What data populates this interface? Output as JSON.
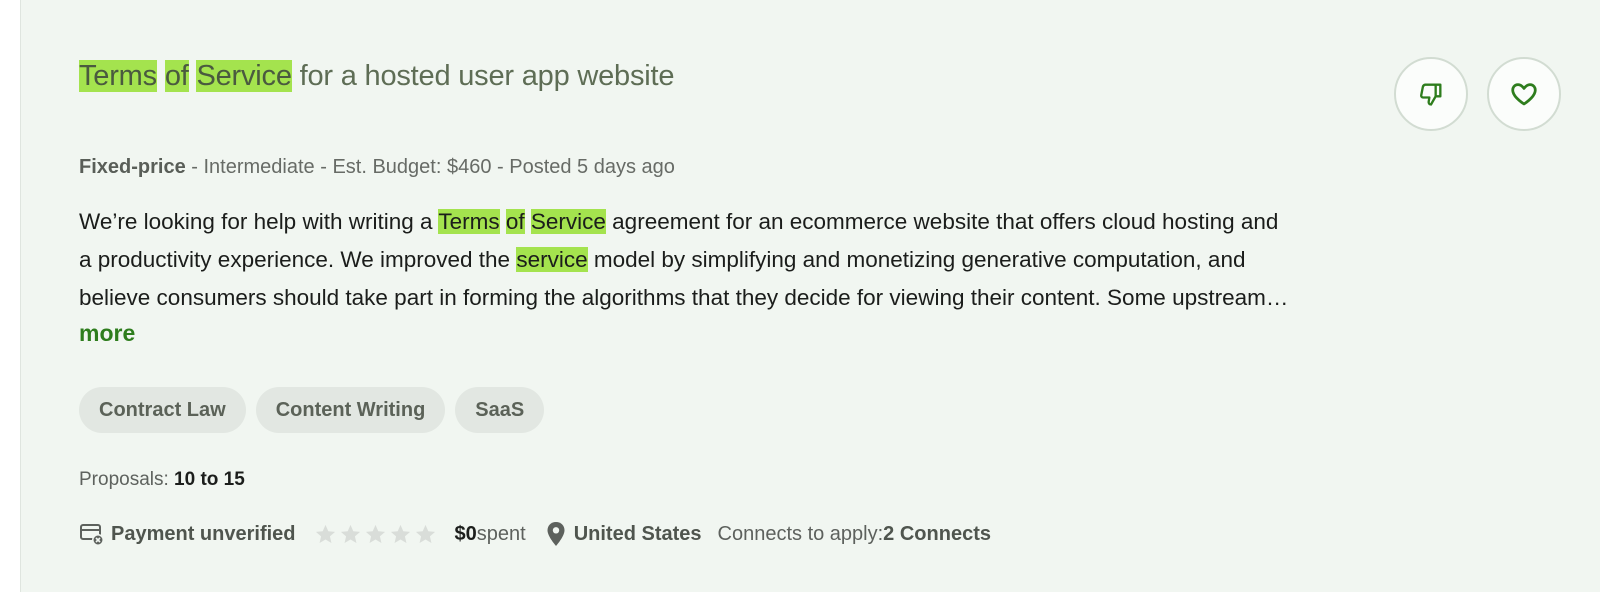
{
  "job": {
    "title_parts": [
      "Terms",
      " ",
      "of",
      " ",
      "Service",
      " for a hosted user app website"
    ],
    "meta": {
      "type": "Fixed-price",
      "sep1": " - ",
      "level": "Intermediate",
      "sep2": " - ",
      "budget": "Est. Budget: $460",
      "sep3": " - ",
      "posted": "Posted 5 days ago"
    },
    "description_lines": [
      [
        "We’re looking for help with writing a ",
        "Terms",
        " ",
        "of",
        " ",
        "Service",
        " agreement for an ecommerce website that offers cloud hosting and"
      ],
      [
        "a productivity experience. We improved the ",
        "service",
        " model by simplifying and monetizing generative computation, and"
      ],
      [
        "believe consumers should take part in forming the algorithms that they decide for viewing their content. Some upstream…"
      ]
    ],
    "more_label": "more",
    "tags": [
      "Contract Law",
      "Content Writing",
      "SaaS"
    ],
    "proposals": {
      "label": "Proposals: ",
      "value": "10 to 15"
    },
    "client": {
      "payment": "Payment unverified",
      "rating_stars": 0,
      "spent_amount": "$0",
      "spent_label": " spent",
      "location": "United States",
      "connects_label": "Connects to apply: ",
      "connects_value": "2 Connects"
    }
  },
  "colors": {
    "highlight": "#a4e34e",
    "accent_green": "#2e7d1d",
    "card_bg": "#f1f6f1"
  },
  "icons": {
    "dislike": "thumbs-down-icon",
    "save": "heart-icon",
    "payment": "card-x-icon",
    "star": "star-icon",
    "location": "map-pin-icon"
  }
}
